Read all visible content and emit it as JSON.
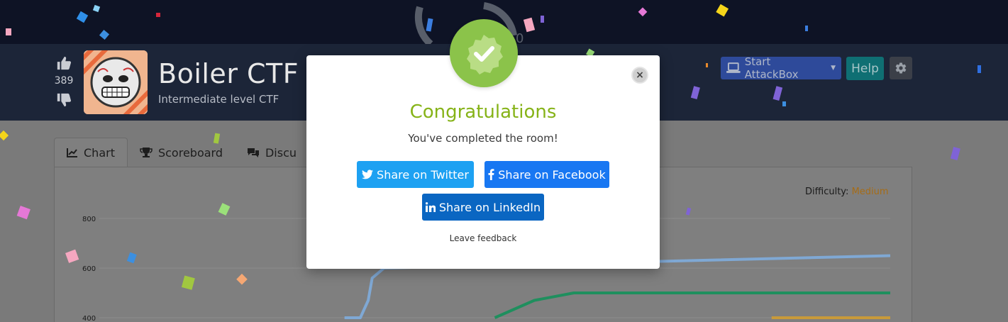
{
  "room": {
    "title": "Boiler CTF",
    "subtitle": "Intermediate level CTF",
    "upvotes": "389"
  },
  "header_buttons": {
    "attackbox_label": "Start AttackBox",
    "help_label": "Help"
  },
  "tabs": [
    {
      "label": "Chart",
      "icon": "chart-line-icon"
    },
    {
      "label": "Scoreboard",
      "icon": "trophy-icon"
    },
    {
      "label": "Discu",
      "icon": "comments-icon"
    }
  ],
  "difficulty": {
    "label": "Difficulty:",
    "value": "Medium",
    "value_color": "#a66c16"
  },
  "chart_data": {
    "type": "line",
    "y_ticks": [
      "800",
      "600",
      "400"
    ],
    "ylim": [
      400,
      800
    ],
    "grid": true,
    "series": [
      {
        "color": "#7fa8d4",
        "points": [
          [
            0.31,
            400
          ],
          [
            0.33,
            400
          ],
          [
            0.34,
            470
          ],
          [
            0.345,
            560
          ],
          [
            0.36,
            600
          ],
          [
            1.0,
            650
          ]
        ]
      },
      {
        "color": "#1f8f5e",
        "points": [
          [
            0.5,
            400
          ],
          [
            0.55,
            470
          ],
          [
            0.6,
            500
          ],
          [
            1.0,
            500
          ]
        ]
      },
      {
        "color": "#c89a3a",
        "points": [
          [
            0.85,
            400
          ],
          [
            1.0,
            400
          ]
        ]
      }
    ]
  },
  "modal": {
    "title": "Congratulations",
    "message": "You've completed the room!",
    "twitter_label": "Share on Twitter",
    "facebook_label": "Share on Facebook",
    "linkedin_label": "Share on LinkedIn",
    "feedback_label": "Leave feedback",
    "close_glyph": "×",
    "accent_color": "#86b318",
    "badge_color": "#8bc34a"
  },
  "colors": {
    "twitter": "#1da1f2",
    "facebook": "#1877f2",
    "linkedin": "#0a66c2",
    "header_bg": "#1c2538"
  }
}
